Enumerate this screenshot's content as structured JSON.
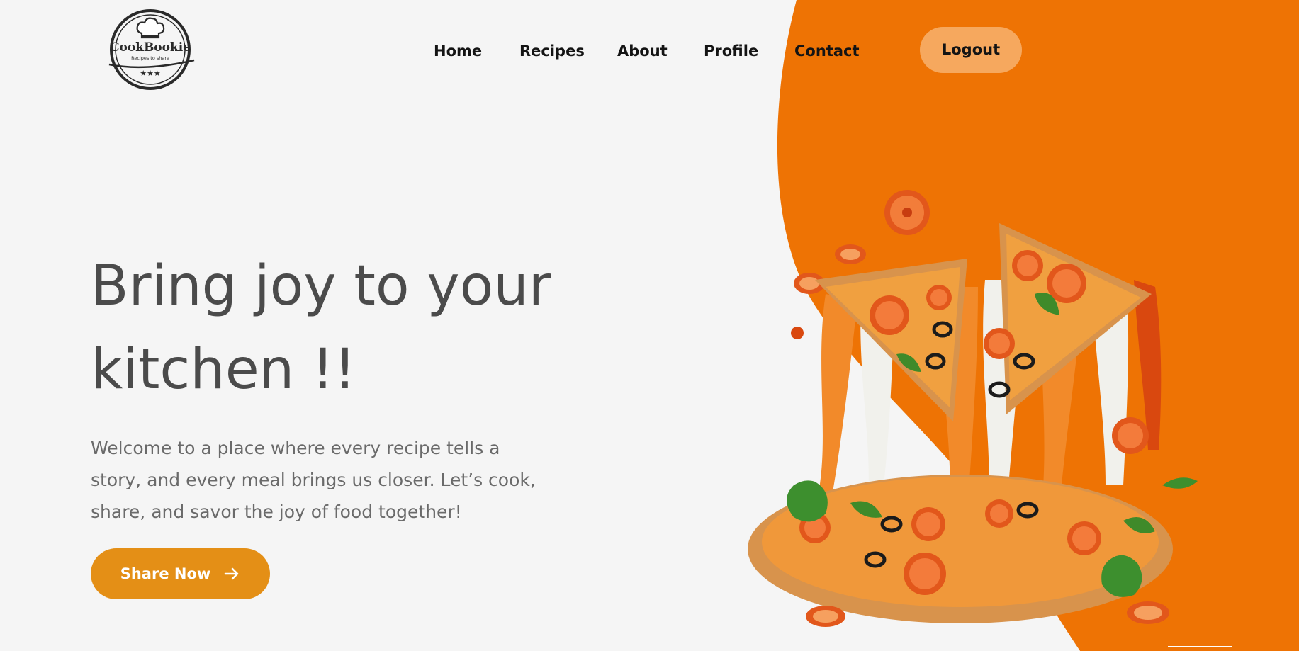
{
  "brand": {
    "name": "CookBookie",
    "tagline": "Recipes to share"
  },
  "nav": {
    "items": [
      {
        "label": "Home"
      },
      {
        "label": "Recipes"
      },
      {
        "label": "About"
      },
      {
        "label": "Profile"
      },
      {
        "label": "Contact"
      }
    ],
    "logout_label": "Logout"
  },
  "hero": {
    "title_line1": "Bring joy to your",
    "title_line2": "kitchen !!",
    "description": "Welcome to a place where every recipe tells a story, and every meal brings us closer. Let’s cook, share, and savor the joy of food together!",
    "cta_label": "Share Now"
  },
  "colors": {
    "accent_orange": "#ee7304",
    "cta_orange": "#e48f16",
    "logout_peach": "#f6a85e",
    "background": "#f5f5f5",
    "heading_gray": "#4b4b4b"
  },
  "icons": {
    "cta_icon": "arrow-right-icon",
    "logo_icon": "chef-hat-icon"
  }
}
